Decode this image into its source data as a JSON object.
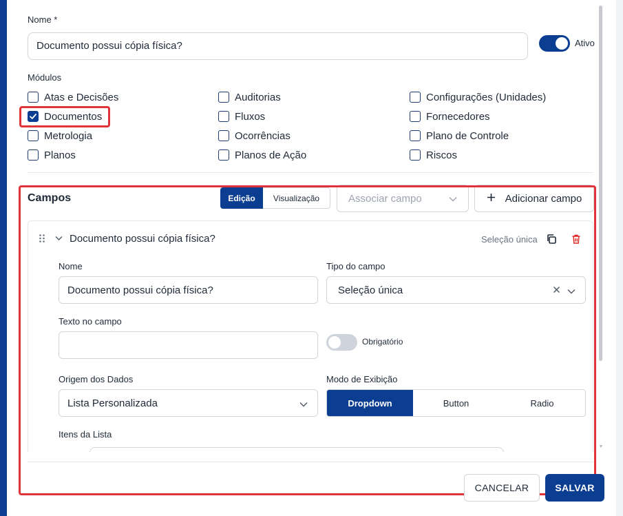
{
  "form": {
    "name_label": "Nome *",
    "name_value": "Documento possui cópia física?",
    "active_label": "Ativo",
    "active": true
  },
  "modules": {
    "label": "Módulos",
    "items": [
      {
        "label": "Atas e Decisões",
        "checked": false
      },
      {
        "label": "Auditorias",
        "checked": false
      },
      {
        "label": "Configurações (Unidades)",
        "checked": false
      },
      {
        "label": "Documentos",
        "checked": true
      },
      {
        "label": "Fluxos",
        "checked": false
      },
      {
        "label": "Fornecedores",
        "checked": false
      },
      {
        "label": "Metrologia",
        "checked": false
      },
      {
        "label": "Ocorrências",
        "checked": false
      },
      {
        "label": "Plano de Controle",
        "checked": false
      },
      {
        "label": "Planos",
        "checked": false
      },
      {
        "label": "Planos de Ação",
        "checked": false
      },
      {
        "label": "Riscos",
        "checked": false
      }
    ]
  },
  "campos": {
    "title": "Campos",
    "tab_edit": "Edição",
    "tab_view": "Visualização",
    "associate_placeholder": "Associar campo",
    "add_field": "Adicionar campo"
  },
  "field": {
    "title": "Documento possui cópia física?",
    "type_tag": "Seleção única",
    "name_label": "Nome",
    "name_value": "Documento possui cópia física?",
    "type_label": "Tipo do campo",
    "type_value": "Seleção única",
    "text_label": "Texto no campo",
    "text_value": "",
    "required_label": "Obrigatório",
    "required": false,
    "origin_label": "Origem dos Dados",
    "origin_value": "Lista Personalizada",
    "mode_label": "Modo de Exibição",
    "modes": [
      "Dropdown",
      "Button",
      "Radio"
    ],
    "active_mode": "Dropdown",
    "list_label": "Itens da Lista"
  },
  "footer": {
    "cancel": "CANCELAR",
    "save": "SALVAR"
  },
  "colors": {
    "primary": "#0b3d91",
    "highlight": "#e0343a",
    "danger": "#dc2626"
  }
}
